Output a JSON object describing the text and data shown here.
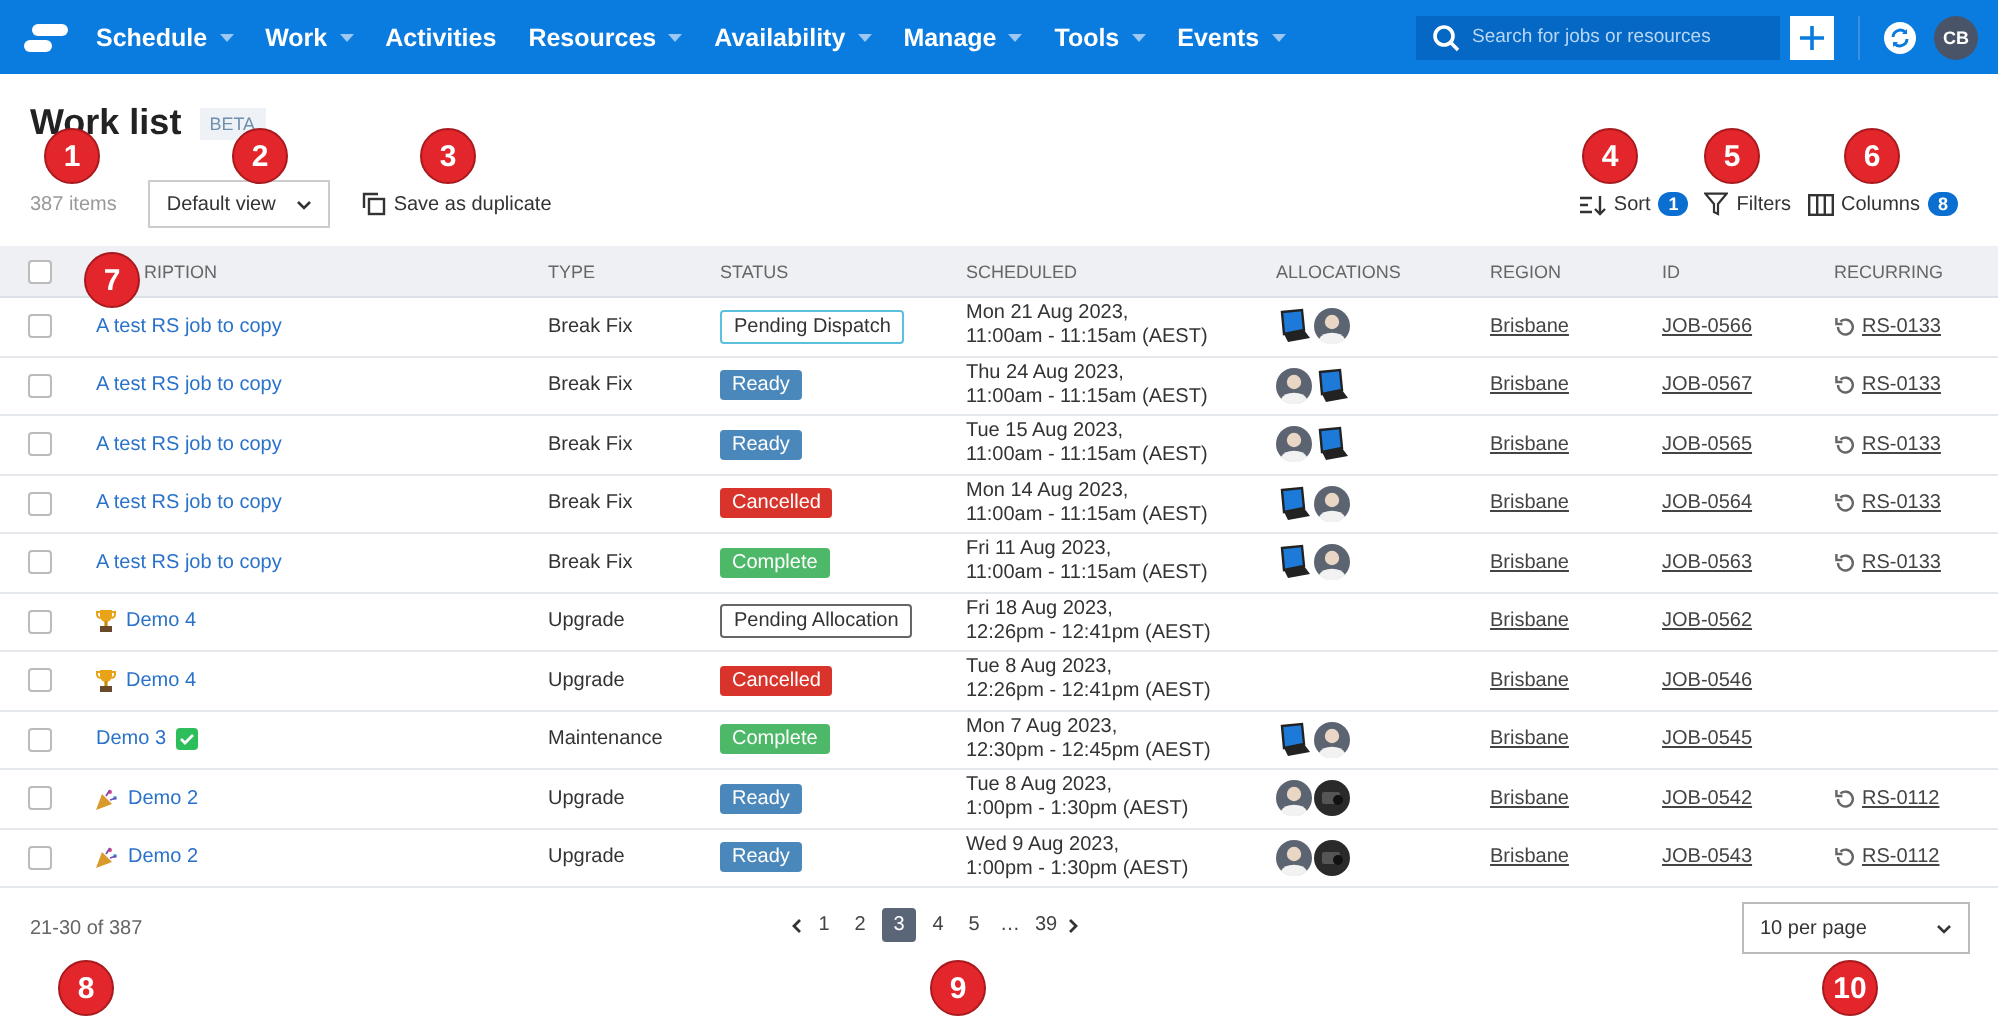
{
  "nav": {
    "items": [
      {
        "label": "Schedule",
        "dropdown": true
      },
      {
        "label": "Work",
        "dropdown": true
      },
      {
        "label": "Activities",
        "dropdown": false
      },
      {
        "label": "Resources",
        "dropdown": true
      },
      {
        "label": "Availability",
        "dropdown": true
      },
      {
        "label": "Manage",
        "dropdown": true
      },
      {
        "label": "Tools",
        "dropdown": true
      },
      {
        "label": "Events",
        "dropdown": true
      }
    ],
    "search": {
      "placeholder": "Search for jobs or resources"
    },
    "user_initials": "CB"
  },
  "page": {
    "title": "Work list",
    "badge": "BETA"
  },
  "toolbar": {
    "count": "387 items",
    "view": "Default view",
    "duplicate": "Save as duplicate",
    "sort": {
      "label": "Sort",
      "count": "1"
    },
    "filters": "Filters",
    "columns": {
      "label": "Columns",
      "count": "8"
    }
  },
  "table": {
    "select_all": {
      "checked": false
    },
    "columns": [
      "RIPTION",
      "TYPE",
      "STATUS",
      "SCHEDULED",
      "ALLOCATIONS",
      "REGION",
      "ID",
      "RECURRING"
    ],
    "rows": [
      {
        "checked": false,
        "description": "A test RS job to copy",
        "type": "Break Fix",
        "status": {
          "label": "Pending Dispatch",
          "kind": "outline-info"
        },
        "scheduled": [
          "Mon 21 Aug 2023,",
          "11:00am - 11:15am (AEST)"
        ],
        "allocations": [
          {
            "kind": "laptop"
          },
          {
            "kind": "person"
          }
        ],
        "region": "Brisbane",
        "id": "JOB-0566",
        "recurring": "RS-0133"
      },
      {
        "checked": false,
        "description": "A test RS job to copy",
        "type": "Break Fix",
        "status": {
          "label": "Ready",
          "kind": "ready"
        },
        "scheduled": [
          "Thu 24 Aug 2023,",
          "11:00am - 11:15am (AEST)"
        ],
        "allocations": [
          {
            "kind": "person"
          },
          {
            "kind": "laptop"
          }
        ],
        "region": "Brisbane",
        "id": "JOB-0567",
        "recurring": "RS-0133"
      },
      {
        "checked": false,
        "description": "A test RS job to copy",
        "type": "Break Fix",
        "status": {
          "label": "Ready",
          "kind": "ready"
        },
        "scheduled": [
          "Tue 15 Aug 2023,",
          "11:00am - 11:15am (AEST)"
        ],
        "allocations": [
          {
            "kind": "person"
          },
          {
            "kind": "laptop"
          }
        ],
        "region": "Brisbane",
        "id": "JOB-0565",
        "recurring": "RS-0133"
      },
      {
        "checked": false,
        "description": "A test RS job to copy",
        "type": "Break Fix",
        "status": {
          "label": "Cancelled",
          "kind": "cancelled"
        },
        "scheduled": [
          "Mon 14 Aug 2023,",
          "11:00am - 11:15am (AEST)"
        ],
        "allocations": [
          {
            "kind": "laptop"
          },
          {
            "kind": "person"
          }
        ],
        "region": "Brisbane",
        "id": "JOB-0564",
        "recurring": "RS-0133"
      },
      {
        "checked": false,
        "description": "A test RS job to copy",
        "type": "Break Fix",
        "status": {
          "label": "Complete",
          "kind": "complete"
        },
        "scheduled": [
          "Fri 11 Aug 2023,",
          "11:00am - 11:15am (AEST)"
        ],
        "allocations": [
          {
            "kind": "laptop"
          },
          {
            "kind": "person"
          }
        ],
        "region": "Brisbane",
        "id": "JOB-0563",
        "recurring": "RS-0133"
      },
      {
        "checked": false,
        "description": "Demo 4",
        "kind": "trophy",
        "type": "Upgrade",
        "status": {
          "label": "Pending Allocation",
          "kind": "outline"
        },
        "scheduled": [
          "Fri 18 Aug 2023,",
          "12:26pm - 12:41pm (AEST)"
        ],
        "region": "Brisbane",
        "id": "JOB-0562"
      },
      {
        "checked": false,
        "description": "Demo 4",
        "kind": "trophy",
        "type": "Upgrade",
        "status": {
          "label": "Cancelled",
          "kind": "cancelled"
        },
        "scheduled": [
          "Tue 8 Aug 2023,",
          "12:26pm - 12:41pm (AEST)"
        ],
        "region": "Brisbane",
        "id": "JOB-0546"
      },
      {
        "checked": false,
        "description": "Demo 3",
        "kind": "check",
        "type": "Maintenance",
        "status": {
          "label": "Complete",
          "kind": "complete"
        },
        "scheduled": [
          "Mon 7 Aug 2023,",
          "12:30pm - 12:45pm (AEST)"
        ],
        "allocations": [
          {
            "kind": "laptop"
          },
          {
            "kind": "person"
          }
        ],
        "region": "Brisbane",
        "id": "JOB-0545"
      },
      {
        "checked": false,
        "description": "Demo 2",
        "kind": "party",
        "type": "Upgrade",
        "status": {
          "label": "Ready",
          "kind": "ready"
        },
        "scheduled": [
          "Tue 8 Aug 2023,",
          "1:00pm - 1:30pm (AEST)"
        ],
        "allocations": [
          {
            "kind": "person"
          },
          {
            "kind": "machine"
          }
        ],
        "region": "Brisbane",
        "id": "JOB-0542",
        "recurring": "RS-0112"
      },
      {
        "checked": false,
        "description": "Demo 2",
        "kind": "party",
        "type": "Upgrade",
        "status": {
          "label": "Ready",
          "kind": "ready"
        },
        "scheduled": [
          "Wed 9 Aug 2023,",
          "1:00pm - 1:30pm (AEST)"
        ],
        "allocations": [
          {
            "kind": "person"
          },
          {
            "kind": "machine"
          }
        ],
        "region": "Brisbane",
        "id": "JOB-0543",
        "recurring": "RS-0112"
      }
    ]
  },
  "footer": {
    "range": "21-30 of 387",
    "pages": [
      {
        "label": "1",
        "selected": false
      },
      {
        "label": "2",
        "selected": false
      },
      {
        "label": "3",
        "selected": true
      },
      {
        "label": "4",
        "selected": false
      },
      {
        "label": "5",
        "selected": false
      },
      {
        "label": "…",
        "selected": false
      },
      {
        "label": "39",
        "selected": false
      }
    ],
    "per_page": "10 per page"
  },
  "callouts": [
    "1",
    "2",
    "3",
    "4",
    "5",
    "6",
    "7",
    "8",
    "9",
    "10"
  ]
}
